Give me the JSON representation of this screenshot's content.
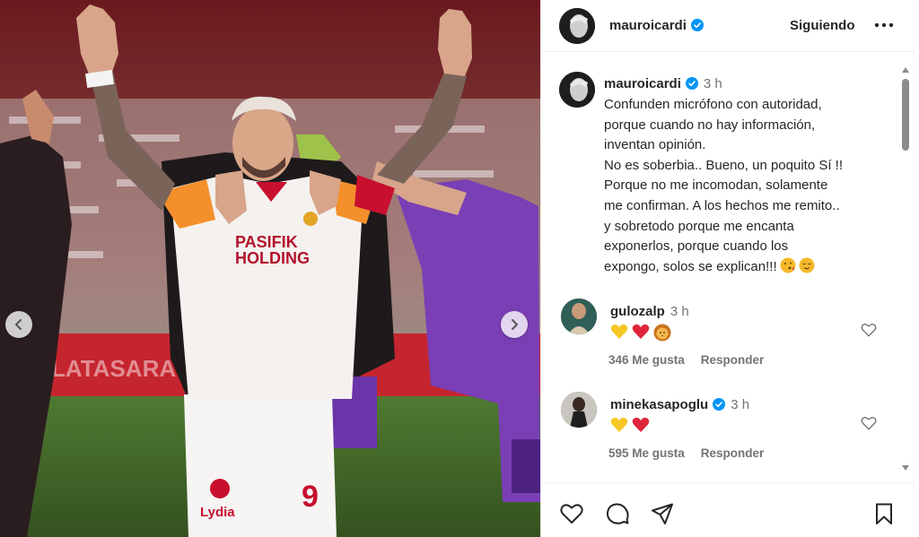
{
  "post": {
    "username": "mauroicardi",
    "follow_label": "Siguiendo",
    "caption_time": "3 h",
    "caption_lines": [
      "Confunden micrófono con autoridad,",
      "porque cuando no hay información,",
      "inventan opinión.",
      "No es soberbia.. Bueno, un poquito Sí !!",
      "Porque no me incomodan, solamente",
      "me confirman. A los hechos me remito..",
      "y sobretodo porque me encanta",
      "exponerlos, porque cuando los",
      "expongo, solos se explican!!!"
    ],
    "caption_emojis": [
      "face-blowing-kiss",
      "relieved-face"
    ]
  },
  "photo": {
    "jersey_sponsor_line1": "PASIFIK",
    "jersey_sponsor_line2": "HOLDING",
    "jersey_number": "9",
    "shorts_sponsor": "Lydia",
    "banner_text": "GALATASARAY"
  },
  "comments": [
    {
      "username": "gulozalp",
      "time": "3 h",
      "verified": false,
      "emojis": [
        "yellow-heart",
        "red-heart",
        "lion-face"
      ],
      "likes": "346 Me gusta",
      "reply_label": "Responder"
    },
    {
      "username": "minekasapoglu",
      "time": "3 h",
      "verified": true,
      "emojis": [
        "yellow-heart",
        "red-heart"
      ],
      "likes": "595 Me gusta",
      "reply_label": "Responder"
    }
  ],
  "icons": {
    "like": "heart-icon",
    "comment": "comment-icon",
    "share": "share-icon",
    "save": "bookmark-icon",
    "more": "more-icon",
    "verified": "verified-badge-icon"
  },
  "colors": {
    "verified_blue": "#0095f6",
    "text_secondary": "#737373",
    "jersey_red": "#b3122b",
    "jersey_orange": "#f3902c",
    "keeper_purple": "#7a3fb5"
  }
}
